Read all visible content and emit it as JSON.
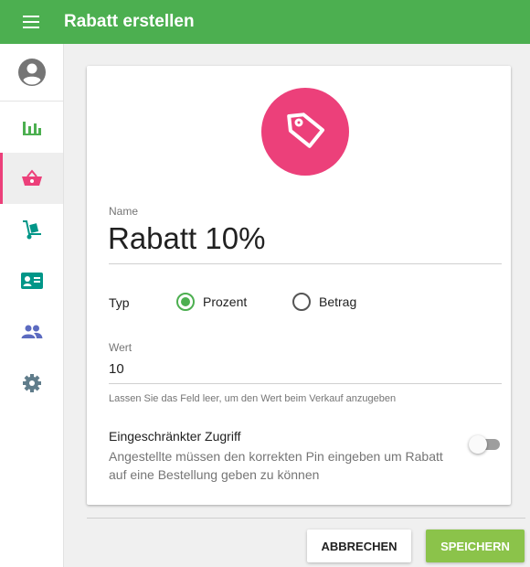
{
  "header": {
    "title": "Rabatt erstellen"
  },
  "sidebar": {
    "items": [
      {
        "name": "statistics",
        "icon": "bar-chart-icon",
        "active": false
      },
      {
        "name": "shop",
        "icon": "shopping-basket-icon",
        "active": true
      },
      {
        "name": "delivery",
        "icon": "hand-truck-icon",
        "active": false
      },
      {
        "name": "contacts",
        "icon": "contact-card-icon",
        "active": false
      },
      {
        "name": "staff",
        "icon": "people-icon",
        "active": false
      },
      {
        "name": "settings",
        "icon": "gear-icon",
        "active": false
      }
    ]
  },
  "form": {
    "icon": "tag-icon",
    "name_label": "Name",
    "name_value": "Rabatt 10%",
    "type_label": "Typ",
    "type_options": [
      {
        "label": "Prozent",
        "checked": true
      },
      {
        "label": "Betrag",
        "checked": false
      }
    ],
    "value_label": "Wert",
    "value_value": "10",
    "value_hint": "Lassen Sie das Feld leer, um den Wert beim Verkauf anzugeben",
    "restricted_title": "Eingeschränkter Zugriff",
    "restricted_description": "Angestellte müssen den korrekten Pin eingeben um Rabatt auf eine Bestellung geben zu können",
    "restricted_enabled": false
  },
  "actions": {
    "cancel_label": "ABBRECHEN",
    "save_label": "SPEICHERN"
  },
  "colors": {
    "primary": "#4caf50",
    "accent": "#ec407a",
    "save_button": "#8bc34a",
    "icon_green": "#4caf50",
    "icon_pink": "#ec407a",
    "icon_teal": "#009688",
    "icon_indigo": "#5c6bc0",
    "icon_gray": "#607d8b"
  }
}
